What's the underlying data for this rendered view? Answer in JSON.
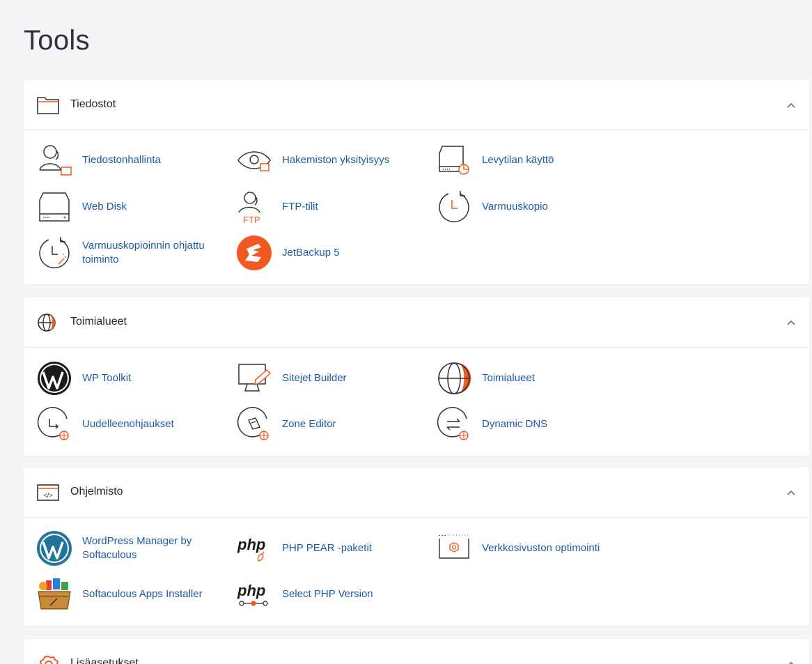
{
  "page": {
    "title": "Tools"
  },
  "colors": {
    "accent": "#f05a22",
    "link": "#1e5aa8",
    "icon": "#2f3137"
  },
  "sections": [
    {
      "title": "Tiedostot",
      "icon": "folder-icon",
      "items": [
        {
          "label": "Tiedostonhallinta",
          "icon": "file-manager-icon"
        },
        {
          "label": "Hakemiston yksityisyys",
          "icon": "directory-privacy-icon"
        },
        {
          "label": "Levytilan käyttö",
          "icon": "disk-usage-icon"
        },
        {
          "label": "Web Disk",
          "icon": "web-disk-icon"
        },
        {
          "label": "FTP-tilit",
          "icon": "ftp-accounts-icon"
        },
        {
          "label": "Varmuuskopio",
          "icon": "backup-icon"
        },
        {
          "label": "Varmuuskopioinnin ohjattu toiminto",
          "icon": "backup-wizard-icon"
        },
        {
          "label": "JetBackup 5",
          "icon": "jetbackup-icon"
        }
      ]
    },
    {
      "title": "Toimialueet",
      "icon": "globe-icon",
      "items": [
        {
          "label": "WP Toolkit",
          "icon": "wordpress-icon"
        },
        {
          "label": "Sitejet Builder",
          "icon": "sitejet-icon"
        },
        {
          "label": "Toimialueet",
          "icon": "domains-icon"
        },
        {
          "label": "Uudelleenohjaukset",
          "icon": "redirects-icon"
        },
        {
          "label": "Zone Editor",
          "icon": "zone-editor-icon"
        },
        {
          "label": "Dynamic DNS",
          "icon": "dynamic-dns-icon"
        }
      ]
    },
    {
      "title": "Ohjelmisto",
      "icon": "code-window-icon",
      "items": [
        {
          "label": "WordPress Manager by Softaculous",
          "icon": "wordpress-manager-icon"
        },
        {
          "label": "PHP PEAR -paketit",
          "icon": "php-pear-icon"
        },
        {
          "label": "Verkkosivuston optimointi",
          "icon": "optimize-website-icon"
        },
        {
          "label": "Softaculous Apps Installer",
          "icon": "softaculous-icon"
        },
        {
          "label": "Select PHP Version",
          "icon": "php-version-icon"
        }
      ]
    },
    {
      "title": "Lisäasetukset",
      "icon": "gear-icon",
      "items": []
    }
  ],
  "glyphs": {
    "php": "php",
    "ftp": "FTP",
    "code": "</>"
  }
}
